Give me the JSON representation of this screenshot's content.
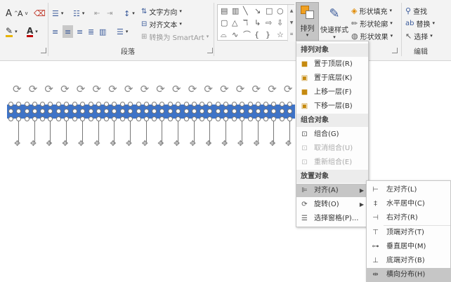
{
  "ribbon": {
    "paragraph_label": "段落",
    "drawing_label": "",
    "editing_label": "编辑",
    "text_direction": "文字方向",
    "align_text": "对齐文本",
    "smartart": "转换为 SmartArt",
    "arrange_label": "排列",
    "quick_styles_label": "快速样式",
    "shape_fill": "形状填充",
    "shape_outline": "形状轮廓",
    "shape_effects": "形状效果",
    "find": "查找",
    "replace": "替换",
    "select": "选择",
    "font_color_accent": "#e8b400",
    "font_color_red": "#c00000"
  },
  "arrange_menu": {
    "sections": [
      {
        "header": "排列对象",
        "items": [
          {
            "label": "置于顶层(R)",
            "icon": "bring-to-front-icon",
            "disabled": false
          },
          {
            "label": "置于底层(K)",
            "icon": "send-to-back-icon",
            "disabled": false
          },
          {
            "label": "上移一层(F)",
            "icon": "bring-forward-icon",
            "disabled": false
          },
          {
            "label": "下移一层(B)",
            "icon": "send-backward-icon",
            "disabled": false
          }
        ]
      },
      {
        "header": "组合对象",
        "items": [
          {
            "label": "组合(G)",
            "icon": "group-icon",
            "disabled": false
          },
          {
            "label": "取消组合(U)",
            "icon": "ungroup-icon",
            "disabled": true
          },
          {
            "label": "重新组合(E)",
            "icon": "regroup-icon",
            "disabled": true
          }
        ]
      },
      {
        "header": "放置对象",
        "items": [
          {
            "label": "对齐(A)",
            "icon": "align-icon",
            "disabled": false,
            "selected": true,
            "submenu": true
          },
          {
            "label": "旋转(O)",
            "icon": "rotate-icon",
            "disabled": false,
            "submenu": true
          },
          {
            "label": "选择窗格(P)...",
            "icon": "selection-pane-icon",
            "disabled": false
          }
        ]
      }
    ]
  },
  "align_submenu": {
    "items": [
      {
        "label": "左对齐(L)",
        "icon": "align-left-icon"
      },
      {
        "label": "水平居中(C)",
        "icon": "align-center-icon"
      },
      {
        "label": "右对齐(R)",
        "icon": "align-right-icon"
      },
      {
        "label": "顶端对齐(T)",
        "icon": "align-top-icon"
      },
      {
        "label": "垂直居中(M)",
        "icon": "align-middle-icon"
      },
      {
        "label": "底端对齐(B)",
        "icon": "align-bottom-icon"
      },
      {
        "label": "横向分布(H)",
        "icon": "distribute-horizontally-icon",
        "selected": true
      }
    ]
  },
  "colors": {
    "bar_blue": "#3e73c7",
    "menu_highlight": "#c6c6c6",
    "menu_header": "#ececec"
  }
}
